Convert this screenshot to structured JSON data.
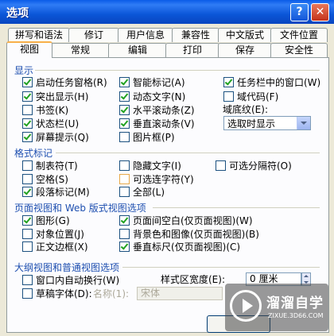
{
  "window": {
    "title": "选项",
    "help": "?",
    "close": "✕"
  },
  "tabs_row1": [
    "拼写和语法",
    "修订",
    "用户信息",
    "兼容性",
    "中文版式",
    "文件位置"
  ],
  "tabs_row2": [
    "视图",
    "常规",
    "编辑",
    "打印",
    "保存",
    "安全性"
  ],
  "display": {
    "title": "显示",
    "items": [
      {
        "label": "启动任务窗格(R)",
        "checked": true
      },
      {
        "label": "智能标记(A)",
        "checked": true
      },
      {
        "label": "任务栏中的窗口(W)",
        "checked": true
      },
      {
        "label": "突出显示(H)",
        "checked": true
      },
      {
        "label": "动态文字(N)",
        "checked": true
      },
      {
        "label": "域代码(F)",
        "checked": false
      },
      {
        "label": "书签(K)",
        "checked": false
      },
      {
        "label": "水平滚动条(Z)",
        "checked": true
      },
      {
        "label": "状态栏(U)",
        "checked": true
      },
      {
        "label": "垂直滚动条(V)",
        "checked": true
      },
      {
        "label": "屏幕提示(Q)",
        "checked": true
      },
      {
        "label": "图片框(P)",
        "checked": false
      }
    ],
    "shading_label": "域底纹(E):",
    "shading_value": "选取时显示"
  },
  "format_marks": {
    "title": "格式标记",
    "items": [
      {
        "label": "制表符(T)",
        "checked": false
      },
      {
        "label": "隐藏文字(I)",
        "checked": false
      },
      {
        "label": "可选分隔符(O)",
        "checked": false
      },
      {
        "label": "空格(S)",
        "checked": false
      },
      {
        "label": "可选连字符(Y)",
        "checked": false
      },
      {
        "label": "段落标记(M)",
        "checked": true
      },
      {
        "label": "全部(L)",
        "checked": false
      }
    ]
  },
  "print_view": {
    "title": "页面视图和 Web 版式视图选项",
    "items": [
      {
        "label": "图形(G)",
        "checked": true
      },
      {
        "label": "页面间空白(仅页面视图)(W)",
        "checked": true
      },
      {
        "label": "对象位置(J)",
        "checked": false
      },
      {
        "label": "背景色和图像(仅页面视图)(B)",
        "checked": false
      },
      {
        "label": "正文边框(X)",
        "checked": false
      },
      {
        "label": "垂直标尺(仅页面视图)(C)",
        "checked": true
      }
    ]
  },
  "outline_view": {
    "title": "大纲视图和普通视图选项",
    "wrap": {
      "label": "窗口内自动换行(W)",
      "checked": false
    },
    "draft_font": {
      "label": "草稿字体(D):",
      "checked": false
    },
    "name_label": "名称(1):",
    "name_value": "宋体",
    "style_width_label": "样式区宽度(E):",
    "style_width_value": "0 厘米"
  },
  "watermark": {
    "text": "溜溜自学",
    "sub": "ZIXUE.3D66.COM"
  },
  "colors": {
    "title_bar": "#0A5BE8",
    "section_title": "#1E4FB0",
    "check": "#21A121"
  }
}
